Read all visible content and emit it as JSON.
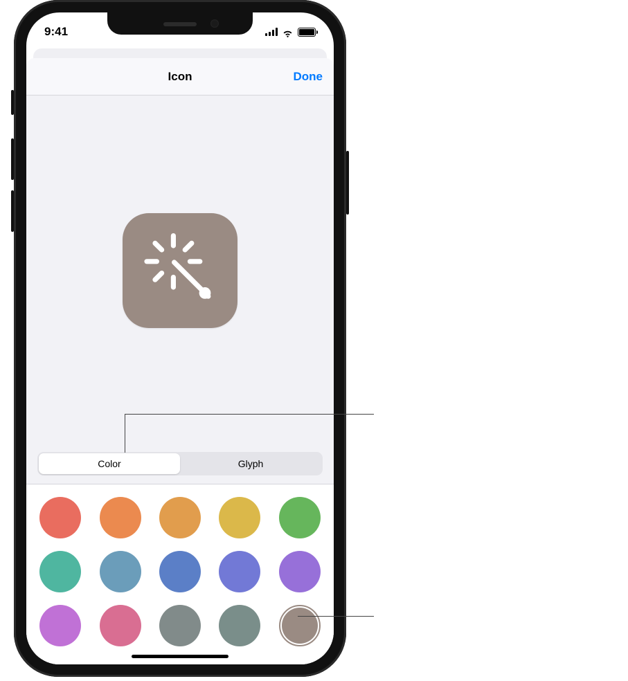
{
  "statusbar": {
    "time": "9:41"
  },
  "sheet": {
    "title": "Icon",
    "done_label": "Done"
  },
  "segmented": {
    "tabs": [
      {
        "label": "Color",
        "active": true
      },
      {
        "label": "Glyph",
        "active": false
      }
    ]
  },
  "icon_preview": {
    "background_color": "#9a8b83",
    "glyph_name": "magic-wand-icon"
  },
  "colors": {
    "swatches": [
      {
        "hex": "#e96d5f",
        "selected": false
      },
      {
        "hex": "#eb8a4f",
        "selected": false
      },
      {
        "hex": "#e19d4d",
        "selected": false
      },
      {
        "hex": "#dbb84a",
        "selected": false
      },
      {
        "hex": "#66b65c",
        "selected": false
      },
      {
        "hex": "#4fb6a0",
        "selected": false
      },
      {
        "hex": "#6b9dba",
        "selected": false
      },
      {
        "hex": "#5b7fc7",
        "selected": false
      },
      {
        "hex": "#7279d6",
        "selected": false
      },
      {
        "hex": "#9770d9",
        "selected": false
      },
      {
        "hex": "#c071d6",
        "selected": false
      },
      {
        "hex": "#d96e92",
        "selected": false
      },
      {
        "hex": "#818b8a",
        "selected": false
      },
      {
        "hex": "#7a8e8a",
        "selected": false
      },
      {
        "hex": "#9a8b83",
        "selected": true
      }
    ]
  }
}
